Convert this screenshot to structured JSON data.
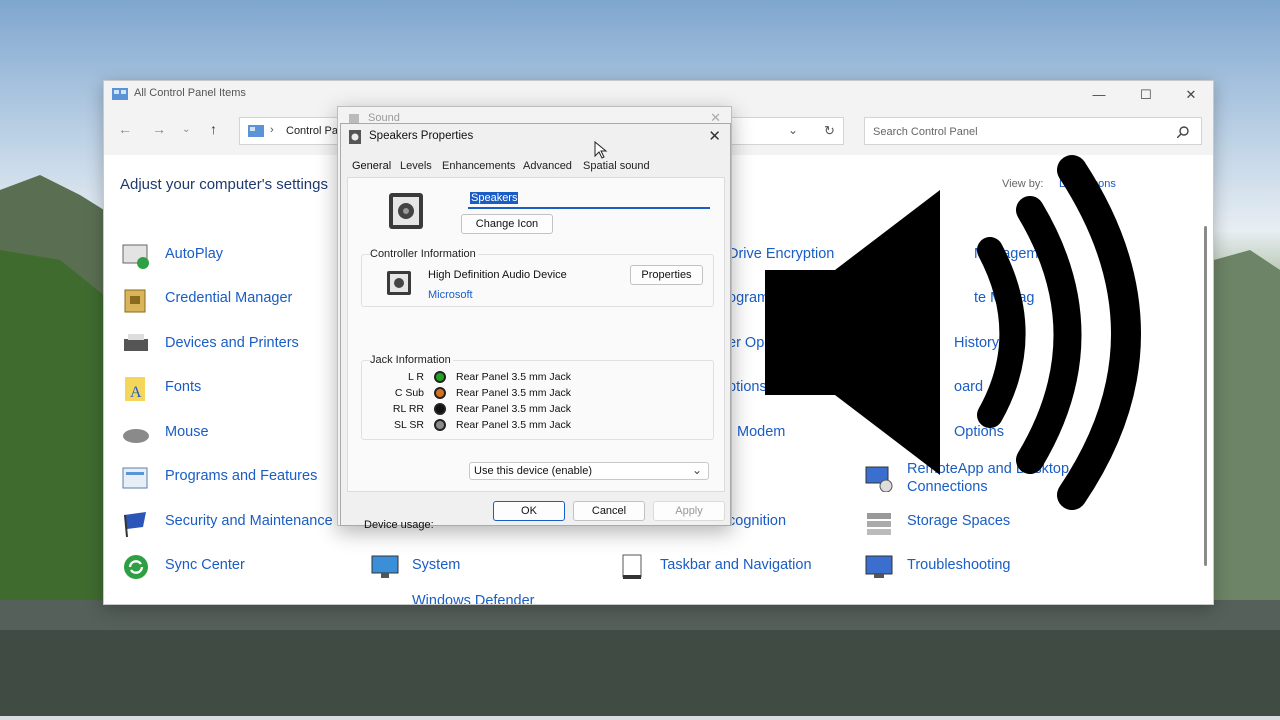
{
  "control_panel": {
    "title": "All Control Panel Items",
    "address": "Control Panel",
    "search_placeholder": "Search Control Panel",
    "heading": "Adjust your computer's settings",
    "view_by_label": "View by:",
    "view_by_value": "Large icons",
    "items_col1": [
      "AutoPlay",
      "Credential Manager",
      "Devices and Printers",
      "Fonts",
      "Mouse",
      "Programs and Features",
      "Security and Maintenance",
      "Sync Center"
    ],
    "items_col2": [
      "System",
      "Windows Defender"
    ],
    "items_col3": [
      "Drive Encryption",
      "ograms",
      "er Op",
      "ptions",
      "Modem",
      "cognition",
      "Taskbar and Navigation"
    ],
    "items_col4": [
      "Management",
      "te Manag",
      "History",
      "oard",
      "Options",
      "RemoteApp and Desktop Connections",
      "Storage Spaces",
      "Troubleshooting"
    ]
  },
  "sound_dialog": {
    "title": "Sound"
  },
  "speakers": {
    "title": "Speakers Properties",
    "tabs": [
      "General",
      "Levels",
      "Enhancements",
      "Advanced",
      "Spatial sound"
    ],
    "name_value": "Speakers",
    "change_icon_label": "Change Icon",
    "controller_group": "Controller Information",
    "controller_name": "High Definition Audio Device",
    "controller_vendor": "Microsoft",
    "properties_label": "Properties",
    "jack_group": "Jack Information",
    "jacks": [
      {
        "name": "L R",
        "text": "Rear Panel 3.5 mm Jack",
        "color": "#1fa321"
      },
      {
        "name": "C Sub",
        "text": "Rear Panel 3.5 mm Jack",
        "color": "#d4701e"
      },
      {
        "name": "RL RR",
        "text": "Rear Panel 3.5 mm Jack",
        "color": "#111111"
      },
      {
        "name": "SL SR",
        "text": "Rear Panel 3.5 mm Jack",
        "color": "#8a8a8a"
      }
    ],
    "device_usage_label": "Device usage:",
    "device_usage_value": "Use this device (enable)",
    "ok_label": "OK",
    "cancel_label": "Cancel",
    "apply_label": "Apply"
  },
  "colors": {
    "accent": "#1a5dc4",
    "link": "#1a5dc4"
  }
}
